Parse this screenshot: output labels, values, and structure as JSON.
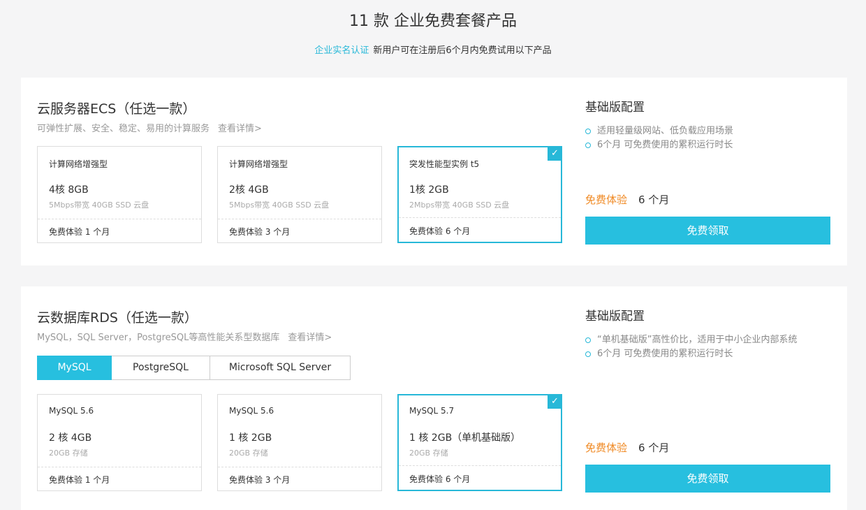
{
  "header": {
    "title": "11 款 企业免费套餐产品",
    "subtitle_link": "企业实名认证",
    "subtitle_text": "新用户可在注册后6个月内免费试用以下产品"
  },
  "ecs": {
    "title": "云服务器ECS（任选一款）",
    "desc": "可弹性扩展、安全、稳定、易用的计算服务",
    "detail_link": "查看详情>",
    "cards": [
      {
        "type": "计算网络增强型",
        "spec": "4核 8GB",
        "extra": "5Mbps带宽 40GB SSD 云盘",
        "foot": "免费体验 1 个月"
      },
      {
        "type": "计算网络增强型",
        "spec": "2核 4GB",
        "extra": "5Mbps带宽 40GB SSD 云盘",
        "foot": "免费体验 3 个月"
      },
      {
        "type": "突发性能型实例 t5",
        "spec": "1核 2GB",
        "extra": "2Mbps带宽 40GB SSD 云盘",
        "foot": "免费体验 6 个月"
      }
    ],
    "side": {
      "title": "基础版配置",
      "features": [
        "适用轻量级网站、低负载应用场景",
        "6个月 可免费使用的累积运行时长"
      ],
      "trial_label": "免费体验",
      "trial_value": "6 个月",
      "button": "免费领取"
    }
  },
  "rds": {
    "title": "云数据库RDS（任选一款）",
    "desc": "MySQL，SQL Server，PostgreSQL等高性能关系型数据库",
    "detail_link": "查看详情>",
    "tabs": [
      "MySQL",
      "PostgreSQL",
      "Microsoft SQL Server"
    ],
    "cards": [
      {
        "type": "MySQL 5.6",
        "spec": "2 核 4GB",
        "extra": "20GB 存储",
        "foot": "免费体验 1 个月"
      },
      {
        "type": "MySQL 5.6",
        "spec": "1 核 2GB",
        "extra": "20GB 存储",
        "foot": "免费体验 3 个月"
      },
      {
        "type": "MySQL 5.7",
        "spec": "1 核 2GB（单机基础版）",
        "extra": "20GB 存储",
        "foot": "免费体验 6 个月"
      }
    ],
    "side": {
      "title": "基础版配置",
      "features": [
        "“单机基础版”高性价比，适用于中小企业内部系统",
        "6个月 可免费使用的累积运行时长"
      ],
      "trial_label": "免费体验",
      "trial_value": "6 个月",
      "button": "免费领取"
    }
  },
  "colors": {
    "accent": "#27bfdf",
    "link": "#27b8d8",
    "trial_label": "#f08a24",
    "background": "#f5f5f6"
  },
  "icons": {
    "check": "checkmark-icon",
    "bullet": "circle-bullet-icon"
  }
}
